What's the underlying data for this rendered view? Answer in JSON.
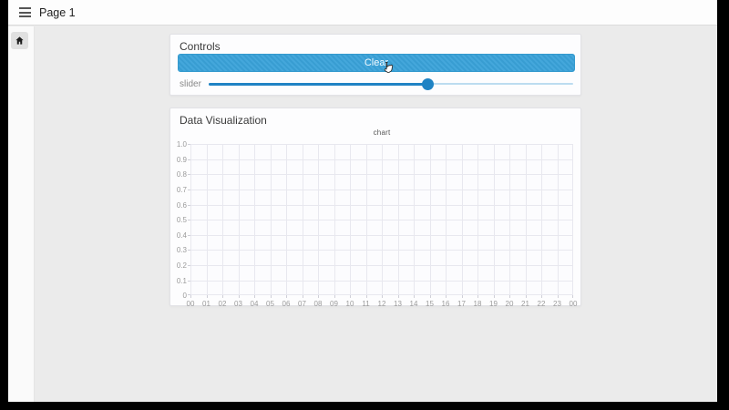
{
  "header": {
    "menu_icon": "hamburger-icon",
    "title": "Page 1"
  },
  "sidebar": {
    "items": [
      {
        "icon": "home-icon"
      }
    ]
  },
  "controls_card": {
    "title": "Controls",
    "clear_button_label": "Clear",
    "slider": {
      "label": "slider",
      "value_percent": 60
    }
  },
  "viz_card": {
    "title": "Data Visualization"
  },
  "chart_data": {
    "type": "line",
    "title": "chart",
    "xlabel": "",
    "ylabel": "",
    "x_tick_labels": [
      "00",
      "01",
      "02",
      "03",
      "04",
      "05",
      "06",
      "07",
      "08",
      "09",
      "10",
      "11",
      "12",
      "13",
      "14",
      "15",
      "16",
      "17",
      "18",
      "19",
      "20",
      "21",
      "22",
      "23",
      "00"
    ],
    "y_tick_labels": [
      "1.0",
      "0.9",
      "0.8",
      "0.7",
      "0.6",
      "0.5",
      "0.4",
      "0.3",
      "0.2",
      "0.1",
      "0"
    ],
    "ylim": [
      0,
      1
    ],
    "grid": true,
    "legend": false,
    "series": []
  },
  "colors": {
    "accent_blue": "#3aa2d9",
    "slider_fill_blue": "#1f83c4",
    "slider_track_light": "#bcdcf0",
    "background_gray": "#ebebeb",
    "letterbox_black": "#000000"
  }
}
